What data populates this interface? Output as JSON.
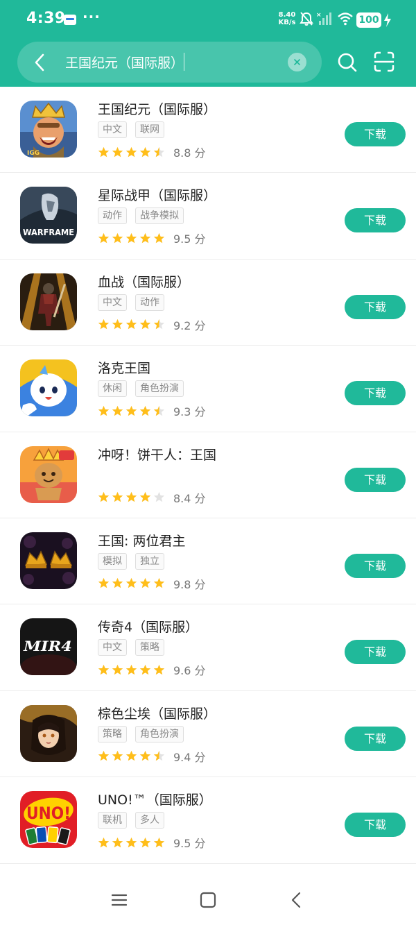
{
  "status_bar": {
    "time": "4:39",
    "more": "···",
    "speed_value": "8.40",
    "speed_unit": "KB/s",
    "battery": "100"
  },
  "search": {
    "query": "王国纪元（国际服）"
  },
  "results": [
    {
      "name": "王国纪元（国际服）",
      "tags": [
        "中文",
        "联网"
      ],
      "rating": 4.5,
      "score": "8.8 分",
      "download": "下载",
      "icon": "lords-mobile-icon"
    },
    {
      "name": "星际战甲（国际服）",
      "tags": [
        "动作",
        "战争模拟"
      ],
      "rating": 5,
      "score": "9.5 分",
      "download": "下载",
      "icon": "warframe-icon",
      "icon_text": "WARFRAME"
    },
    {
      "name": "血战（国际服）",
      "tags": [
        "中文",
        "动作"
      ],
      "rating": 4.5,
      "score": "9.2 分",
      "download": "下载",
      "icon": "bloody-war-icon"
    },
    {
      "name": "洛克王国",
      "tags": [
        "休闲",
        "角色扮演"
      ],
      "rating": 4.5,
      "score": "9.3 分",
      "download": "下载",
      "icon": "roco-kingdom-icon"
    },
    {
      "name": "冲呀！饼干人：王国",
      "tags": [],
      "rating": 4,
      "score": "8.4 分",
      "download": "下载",
      "icon": "cookie-run-icon"
    },
    {
      "name": "王国: 两位君主",
      "tags": [
        "模拟",
        "独立"
      ],
      "rating": 5,
      "score": "9.8 分",
      "download": "下载",
      "icon": "kingdom-two-crowns-icon"
    },
    {
      "name": "传奇4（国际服）",
      "tags": [
        "中文",
        "策略"
      ],
      "rating": 5,
      "score": "9.6 分",
      "download": "下载",
      "icon": "mir4-icon",
      "icon_text": "MIR4"
    },
    {
      "name": "棕色尘埃（国际服）",
      "tags": [
        "策略",
        "角色扮演"
      ],
      "rating": 4.5,
      "score": "9.4 分",
      "download": "下载",
      "icon": "brown-dust-icon"
    },
    {
      "name": "UNO!™（国际服）",
      "tags": [
        "联机",
        "多人"
      ],
      "rating": 5,
      "score": "9.5 分",
      "download": "下载",
      "icon": "uno-icon",
      "icon_text": "UNO!"
    }
  ],
  "colors": {
    "accent": "#20b99a",
    "star": "#ffbe1a",
    "star_empty": "#e2e2e2"
  },
  "icons": {
    "back": "chevron-left-icon",
    "clear": "close-circle-icon",
    "search": "search-icon",
    "scan": "scan-icon",
    "nav_menu": "menu-icon",
    "nav_home": "home-square-icon",
    "nav_back": "back-arrow-icon"
  }
}
